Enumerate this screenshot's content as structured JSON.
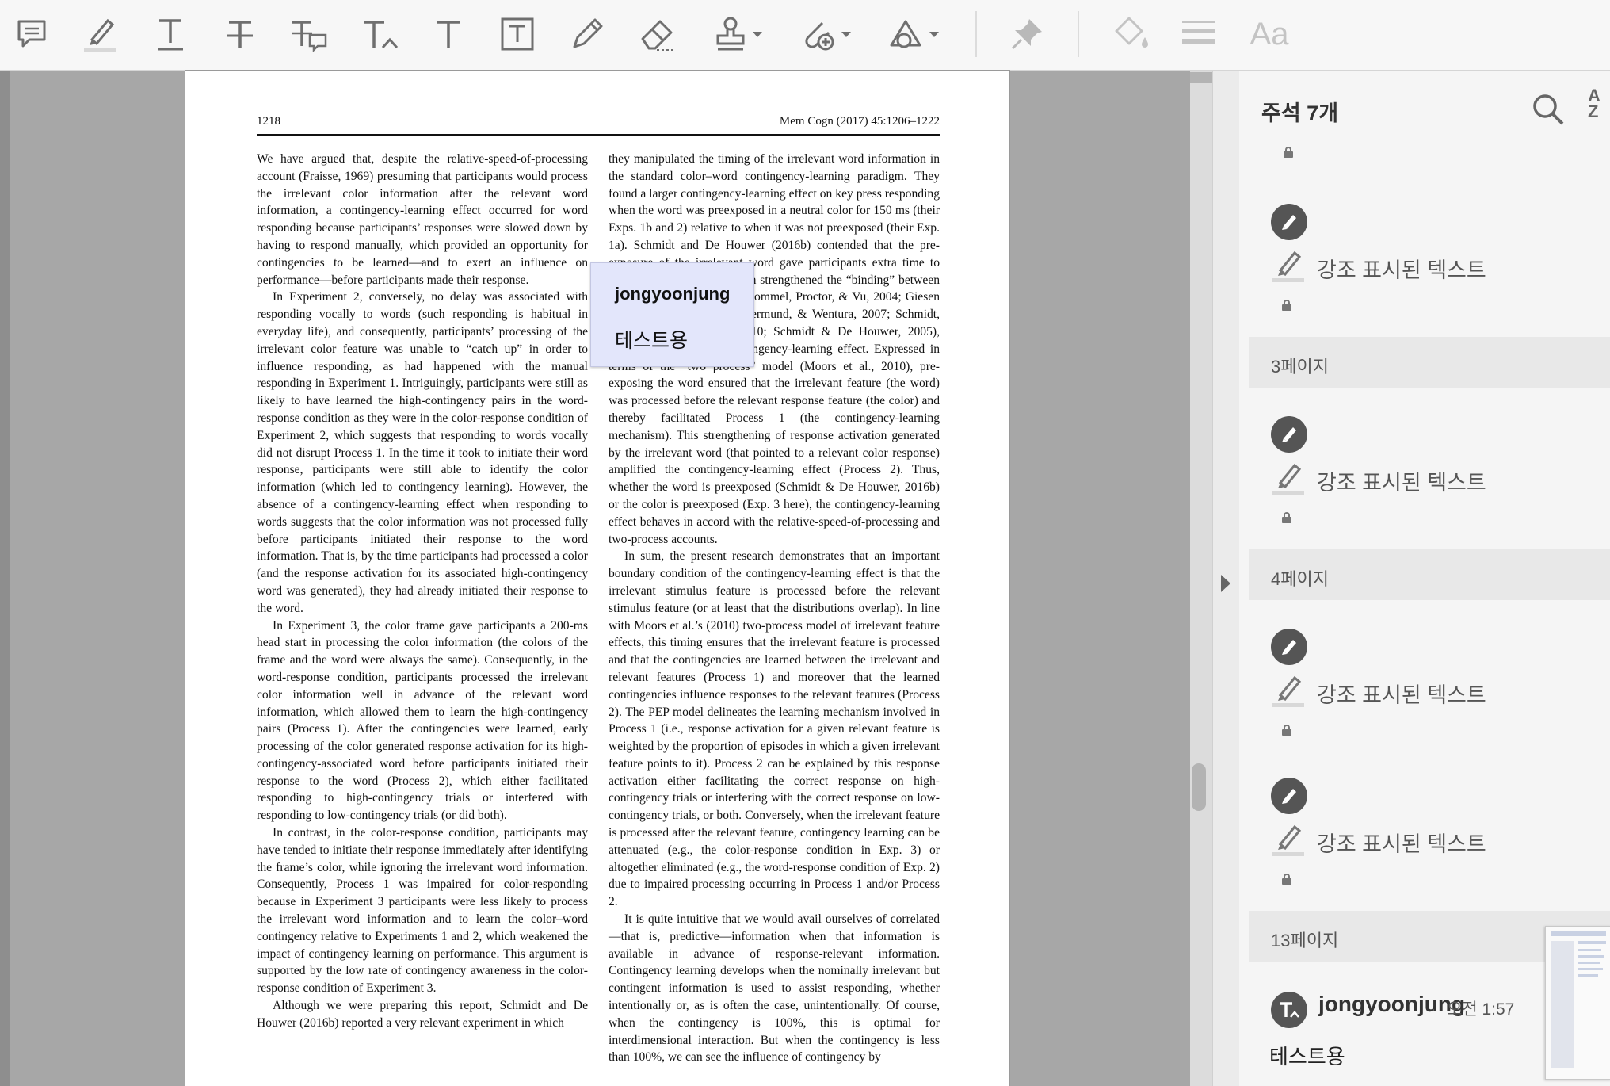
{
  "toolbar": {
    "tools": [
      {
        "name": "sticky-note-icon"
      },
      {
        "name": "highlight-icon"
      },
      {
        "name": "underline-text-icon"
      },
      {
        "name": "strikethrough-icon"
      },
      {
        "name": "replace-text-icon"
      },
      {
        "name": "insert-text-icon"
      },
      {
        "name": "add-text-icon"
      },
      {
        "name": "text-box-icon"
      },
      {
        "name": "pencil-icon"
      },
      {
        "name": "eraser-icon"
      },
      {
        "name": "stamp-icon"
      },
      {
        "name": "attach-icon"
      },
      {
        "name": "shapes-icon"
      },
      {
        "name": "pin-icon"
      },
      {
        "name": "fill-color-icon"
      },
      {
        "name": "line-weight-icon"
      },
      {
        "name": "font-size-icon"
      }
    ],
    "font_label": "Aa"
  },
  "document": {
    "page_number": "1218",
    "journal_ref": "Mem Cogn (2017) 45:1206–1222",
    "left_column": [
      "We have argued that, despite the relative-speed-of-processing account (Fraisse, 1969) presuming that participants would process the irrelevant color information after the relevant word information, a contingency-learning effect occurred for word responding because participants’ responses were slowed down by having to respond manually, which provided an opportunity for contingencies to be learned—and to exert an influence on performance—before participants made their response.",
      "In Experiment 2, conversely, no delay was associated with responding vocally to words (such responding is habitual in everyday life), and consequently, participants’ processing of the irrelevant color feature was unable to “catch up” in order to influence responding, as had happened with the manual responding in Experiment 1. Intriguingly, participants were still as likely to have learned the high-contingency pairs in the word-response condition as they were in the color-response condition of Experiment 2, which suggests that responding to words vocally did not disrupt Process 1. In the time it took to initiate their word response, participants were still able to identify the color information (which led to contingency learning). However, the absence of a contingency-learning effect when responding to words suggests that the color information was not processed fully before participants initiated their response to the word information. That is, by the time participants had processed a color (and the response activation for its associated high-contingency word was generated), they had already initiated their response to the word.",
      "In Experiment 3, the color frame gave participants a 200-ms head start in processing the color information (the colors of the frame and the word were always the same). Consequently, in the word-response condition, participants processed the irrelevant color information well in advance of the relevant word information, which allowed them to learn the high-contingency pairs (Process 1). After the contingencies were learned, early processing of the color generated response activation for its high-contingency-associated word before participants initiated their response to the word (Process 2), which either facilitated responding to high-contingency trials or interfered with responding to low-contingency trials (or did both).",
      "In contrast, in the color-response condition, participants may have tended to initiate their response immediately after identifying the frame’s color, while ignoring the irrelevant word information. Consequently, Process 1 was impaired for color-responding because in Experiment 3 participants were less likely to process the irrelevant word information and to learn the color–word contingency relative to Experiments 1 and 2, which weakened the impact of contingency learning on performance. This argument is supported by the low rate of contingency awareness in the color-response condition of Experiment 3.",
      "Although we were preparing this report, Schmidt and De Houwer (2016b) reported a very relevant experiment in which"
    ],
    "right_column": [
      "they manipulated the timing of the irrelevant word information in the standard color–word contingency-learning paradigm. They found a larger contingency-learning effect on key press responding when the word was preexposed in a neutral color for 150 ms (their Exps. 1b and 2) relative to when it was not preexposed (their Exp. 1a). Schmidt and De Houwer (2016b) contended that the pre-exposure of the irrelevant word gave participants extra time to prepare their response, which strengthened the “binding” between words and responses (e.g., Hommel, Proctor, & Vu, 2004; Giesen & Rothermund, 2014; Rothermund, & Wentura, 2007; Schmidt, De Houwer, & Besner, 2010; Schmidt & De Houwer, 2005), thereby enhancing the contingency-learning effect. Expressed in terms of the “two process” model (Moors et al., 2010), pre-exposing the word ensured that the irrelevant feature (the word) was processed before the relevant response feature (the color) and thereby facilitated Process 1 (the contingency-learning mechanism). This strengthening of response activation generated by the irrelevant word (that pointed to a relevant color response) amplified the contingency-learning effect (Process 2). Thus, whether the word is preexposed (Schmidt & De Houwer, 2016b) or the color is preexposed (Exp. 3 here), the contingency-learning effect behaves in accord with the relative-speed-of-processing and two-process accounts.",
      "In sum, the present research demonstrates that an important boundary condition of the contingency-learning effect is that the irrelevant stimulus feature is processed before the relevant stimulus feature (or at least that the distributions overlap). In line with Moors et al.’s (2010) two-process model of irrelevant feature effects, this timing ensures that the irrelevant feature is processed and that the contingencies are learned between the irrelevant and relevant features (Process 1) and moreover that the learned contingencies influence responses to the relevant features (Process 2). The PEP model delineates the learning mechanism involved in Process 1 (i.e., response activation for a given relevant feature is weighted by the proportion of episodes in which a given irrelevant feature points to it). Process 2 can be explained by this response activation either facilitating the correct response on high-contingency trials or interfering with the correct response on low-contingency trials, or both. Conversely, when the irrelevant feature is processed after the relevant feature, contingency learning can be attenuated (e.g., the color-response condition in Exp. 3) or altogether eliminated (e.g., the word-response condition of Exp. 2) due to impaired processing occurring in Process 1 and/or Process 2.",
      "It is quite intuitive that we would avail ourselves of correlated—that is, predictive—information when that information is available in advance of response-relevant information. Contingency learning develops when the nominally irrelevant but contingent information is used to assist responding, whether intentionally or, as is often the case, unintentionally. Of course, when the contingency is 100%, this is optimal for interdimensional interaction. But when the contingency is less than 100%, we can see the influence of contingency by"
    ]
  },
  "popup_note": {
    "author": "jongyoonjung",
    "text": "테스트용"
  },
  "panel": {
    "title": "주석 7개",
    "search_icon": "search-icon",
    "sort_label_top": "A",
    "sort_label_bottom": "Z",
    "highlight_label": "강조 표시된 텍스트",
    "sections": [
      "3페이지",
      "4페이지",
      "13페이지"
    ],
    "comment": {
      "author": "jongyoonjung",
      "time": "오전 1:57",
      "text": "테스트용"
    }
  },
  "colors": {
    "accent_link": "#233a9e",
    "popup_bg": "#e3e6fb",
    "panel_bg": "#f5f5f5"
  }
}
